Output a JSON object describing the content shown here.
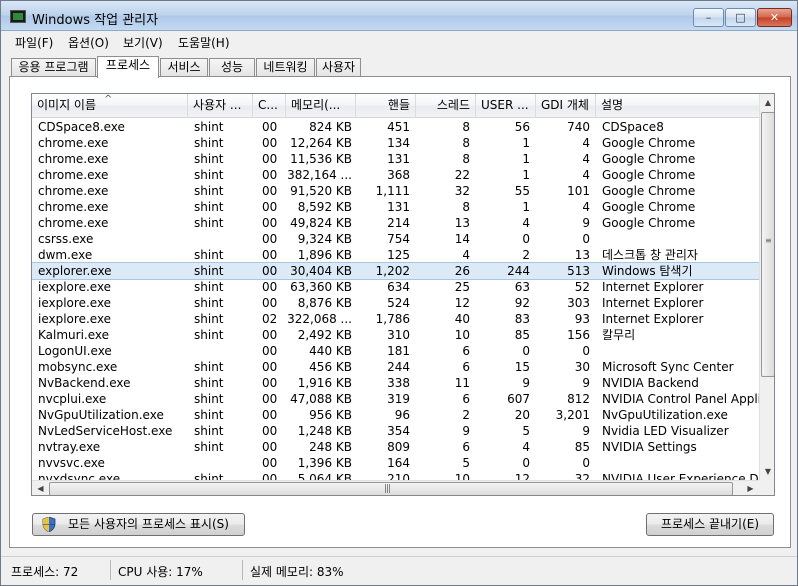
{
  "window": {
    "title": "Windows 작업 관리자"
  },
  "titlebar": {
    "min_glyph": "–",
    "max_glyph": "□",
    "close_glyph": "✕"
  },
  "menu": [
    "파일(F)",
    "옵션(O)",
    "보기(V)",
    "도움말(H)"
  ],
  "tabs": [
    "응용 프로그램",
    "프로세스",
    "서비스",
    "성능",
    "네트워킹",
    "사용자"
  ],
  "active_tab": "프로세스",
  "columns": [
    "이미지 이름",
    "사용자 ...",
    "C...",
    "메모리(...",
    "핸들",
    "스레드",
    "USER ...",
    "GDI 개체",
    "설명"
  ],
  "sort_glyph": "^",
  "selected_row": 9,
  "rows": [
    [
      "CDSpace8.exe",
      "shint",
      "00",
      "824 KB",
      "451",
      "8",
      "56",
      "740",
      "CDSpace8"
    ],
    [
      "chrome.exe",
      "shint",
      "00",
      "12,264 KB",
      "134",
      "8",
      "1",
      "4",
      "Google Chrome"
    ],
    [
      "chrome.exe",
      "shint",
      "00",
      "11,536 KB",
      "131",
      "8",
      "1",
      "4",
      "Google Chrome"
    ],
    [
      "chrome.exe",
      "shint",
      "00",
      "382,164 ...",
      "368",
      "22",
      "1",
      "4",
      "Google Chrome"
    ],
    [
      "chrome.exe",
      "shint",
      "00",
      "91,520 KB",
      "1,111",
      "32",
      "55",
      "101",
      "Google Chrome"
    ],
    [
      "chrome.exe",
      "shint",
      "00",
      "8,592 KB",
      "131",
      "8",
      "1",
      "4",
      "Google Chrome"
    ],
    [
      "chrome.exe",
      "shint",
      "00",
      "49,824 KB",
      "214",
      "13",
      "4",
      "9",
      "Google Chrome"
    ],
    [
      "csrss.exe",
      "",
      "00",
      "9,324 KB",
      "754",
      "14",
      "0",
      "0",
      ""
    ],
    [
      "dwm.exe",
      "shint",
      "00",
      "1,896 KB",
      "125",
      "4",
      "2",
      "13",
      "데스크톱 창 관리자"
    ],
    [
      "explorer.exe",
      "shint",
      "00",
      "30,404 KB",
      "1,202",
      "26",
      "244",
      "513",
      "Windows 탐색기"
    ],
    [
      "iexplore.exe",
      "shint",
      "00",
      "63,360 KB",
      "634",
      "25",
      "63",
      "52",
      "Internet Explorer"
    ],
    [
      "iexplore.exe",
      "shint",
      "00",
      "8,876 KB",
      "524",
      "12",
      "92",
      "303",
      "Internet Explorer"
    ],
    [
      "iexplore.exe",
      "shint",
      "02",
      "322,068 ...",
      "1,786",
      "40",
      "83",
      "93",
      "Internet Explorer"
    ],
    [
      "Kalmuri.exe",
      "shint",
      "00",
      "2,492 KB",
      "310",
      "10",
      "85",
      "156",
      "칼무리"
    ],
    [
      "LogonUI.exe",
      "",
      "00",
      "440 KB",
      "181",
      "6",
      "0",
      "0",
      ""
    ],
    [
      "mobsync.exe",
      "shint",
      "00",
      "456 KB",
      "244",
      "6",
      "15",
      "30",
      "Microsoft Sync Center"
    ],
    [
      "NvBackend.exe",
      "shint",
      "00",
      "1,916 KB",
      "338",
      "11",
      "9",
      "9",
      "NVIDIA Backend"
    ],
    [
      "nvcplui.exe",
      "shint",
      "00",
      "47,088 KB",
      "319",
      "6",
      "607",
      "812",
      "NVIDIA Control Panel Applic"
    ],
    [
      "NvGpuUtilization.exe",
      "shint",
      "00",
      "956 KB",
      "96",
      "2",
      "20",
      "3,201",
      "NvGpuUtilization.exe"
    ],
    [
      "NvLedServiceHost.exe",
      "shint",
      "00",
      "1,248 KB",
      "354",
      "9",
      "5",
      "9",
      "Nvidia LED Visualizer"
    ],
    [
      "nvtray.exe",
      "shint",
      "00",
      "248 KB",
      "809",
      "6",
      "4",
      "85",
      "NVIDIA Settings"
    ],
    [
      "nvvsvc.exe",
      "",
      "00",
      "1,396 KB",
      "164",
      "5",
      "0",
      "0",
      ""
    ],
    [
      "nvxdsync.exe",
      "shint",
      "00",
      "5,064 KB",
      "210",
      "10",
      "12",
      "32",
      "NVIDIA User Experience Dri"
    ]
  ],
  "buttons": {
    "show_all": "모든 사용자의 프로세스 표시(S)",
    "end_process": "프로세스 끝내기(E)"
  },
  "scroll": {
    "up": "▲",
    "down": "▼",
    "left": "◀",
    "right": "▶",
    "vgrip": "≡",
    "hgrip": "|||"
  },
  "status": {
    "processes": "프로세스: 72",
    "cpu": "CPU 사용: 17%",
    "memory": "실제 메모리: 83%"
  }
}
